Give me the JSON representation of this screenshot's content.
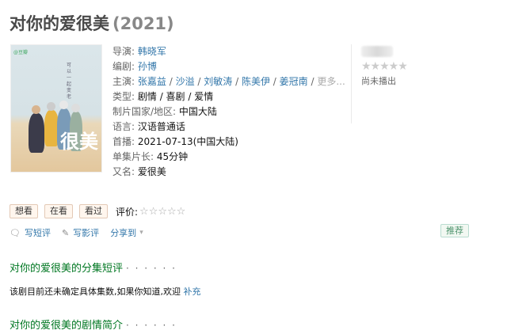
{
  "title": {
    "name": "对你的爱很美",
    "year": "(2021)"
  },
  "poster": {
    "watermark": "@豆瓣",
    "sky_text": "可\n以\n一\n起\n变\n老",
    "overlay_title": "很美"
  },
  "info": {
    "director_label": "导演:",
    "director": "韩晓军",
    "writer_label": "编剧:",
    "writer": "孙博",
    "cast_label": "主演:",
    "cast": [
      "张嘉益",
      "沙溢",
      "刘敏涛",
      "陈美伊",
      "姜冠南"
    ],
    "cast_more": "更多...",
    "genre_label": "类型:",
    "genres": "剧情 / 喜剧 / 爱情",
    "region_label": "制片国家/地区:",
    "region": "中国大陆",
    "language_label": "语言:",
    "language": "汉语普通话",
    "premiere_label": "首播:",
    "premiere": "2021-07-13(中国大陆)",
    "episode_len_label": "单集片长:",
    "episode_len": "45分钟",
    "aka_label": "又名:",
    "aka": "爱很美"
  },
  "rating": {
    "stars": "★★★★★",
    "note": "尚未播出"
  },
  "buttons": {
    "want": "想看",
    "watching": "在看",
    "watched": "看过",
    "eval_label": "评价:",
    "eval_stars": "☆☆☆☆☆"
  },
  "actions": {
    "short_review": "写短评",
    "review": "写影评",
    "share": "分享到",
    "recommend": "推荐"
  },
  "sections": {
    "episode_reviews_title": "对你的爱很美的分集短评",
    "episode_reviews_dots": "· · · · · ·",
    "episode_note": "该剧目前还未确定具体集数,如果你知道,欢迎",
    "episode_note_link": "补充",
    "synopsis_title": "对你的爱很美的剧情简介",
    "synopsis_dots": "· · · · · ·"
  },
  "colors": {
    "link": "#3377aa",
    "section_green": "#007722",
    "button_bg": "#fff6ee"
  }
}
